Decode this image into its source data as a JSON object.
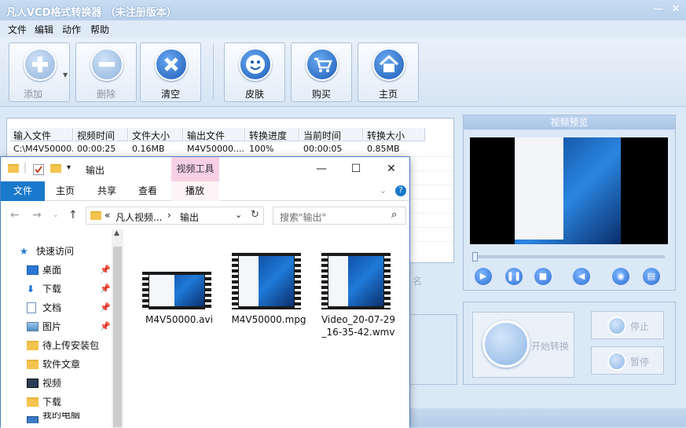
{
  "app": {
    "title": "凡人VCD格式转换器 （未注册版本）",
    "menu": [
      "文件",
      "编辑",
      "动作",
      "帮助"
    ],
    "toolbar": [
      {
        "label": "添加",
        "icon": "plus-icon",
        "enabled": false
      },
      {
        "label": "删除",
        "icon": "minus-icon",
        "enabled": false
      },
      {
        "label": "清空",
        "icon": "clear-icon",
        "enabled": true
      },
      {
        "label": "皮肤",
        "icon": "smiley-icon",
        "enabled": true
      },
      {
        "label": "购买",
        "icon": "cart-icon",
        "enabled": true
      },
      {
        "label": "主页",
        "icon": "home-icon",
        "enabled": true
      }
    ],
    "table": {
      "columns": [
        "输入文件",
        "视频时间",
        "文件大小",
        "输出文件",
        "转换进度",
        "当前时间",
        "转换大小"
      ],
      "rows": [
        [
          "C:\\M4V50000...",
          "00:00:25",
          "0.16MB",
          "M4V50000....",
          "100%",
          "00:00:05",
          "0.85MB"
        ]
      ]
    },
    "preview": {
      "title": "视频预览"
    },
    "convert": {
      "start_label": "开始转换",
      "stop_label": "停止",
      "pause_label": "暂停"
    },
    "background_fragment": "名"
  },
  "explorer": {
    "title": "输出",
    "context_tab": "视频工具",
    "ribbon_tabs": [
      "文件",
      "主页",
      "共享",
      "查看",
      "播放"
    ],
    "address": {
      "prefix": "«",
      "part1": "凡人视频...",
      "sep": "›",
      "part2": "输出"
    },
    "search_placeholder": "搜索\"输出\"",
    "nav": [
      {
        "label": "快速访问",
        "icon": "star-icon",
        "pinned": false
      },
      {
        "label": "桌面",
        "icon": "desktop-icon",
        "pinned": true
      },
      {
        "label": "下载",
        "icon": "download-icon",
        "pinned": true
      },
      {
        "label": "文档",
        "icon": "document-icon",
        "pinned": true
      },
      {
        "label": "图片",
        "icon": "picture-icon",
        "pinned": true
      },
      {
        "label": "待上传安装包",
        "icon": "folder-icon",
        "pinned": false
      },
      {
        "label": "软件文章",
        "icon": "folder-icon",
        "pinned": false
      },
      {
        "label": "视频",
        "icon": "video-icon",
        "pinned": false
      },
      {
        "label": "下载",
        "icon": "folder-icon",
        "pinned": false
      },
      {
        "label": "我的电脑",
        "icon": "computer-icon",
        "pinned": false
      }
    ],
    "files": [
      {
        "name": "M4V50000.avi"
      },
      {
        "name": "M4V50000.mpg"
      },
      {
        "name": "Video_20-07-29\n_16-35-42.wmv"
      }
    ]
  },
  "colors": {
    "accent": "#1979ca",
    "context_tab": "#f7d0e4",
    "app_bg": "#dbe8f6"
  }
}
